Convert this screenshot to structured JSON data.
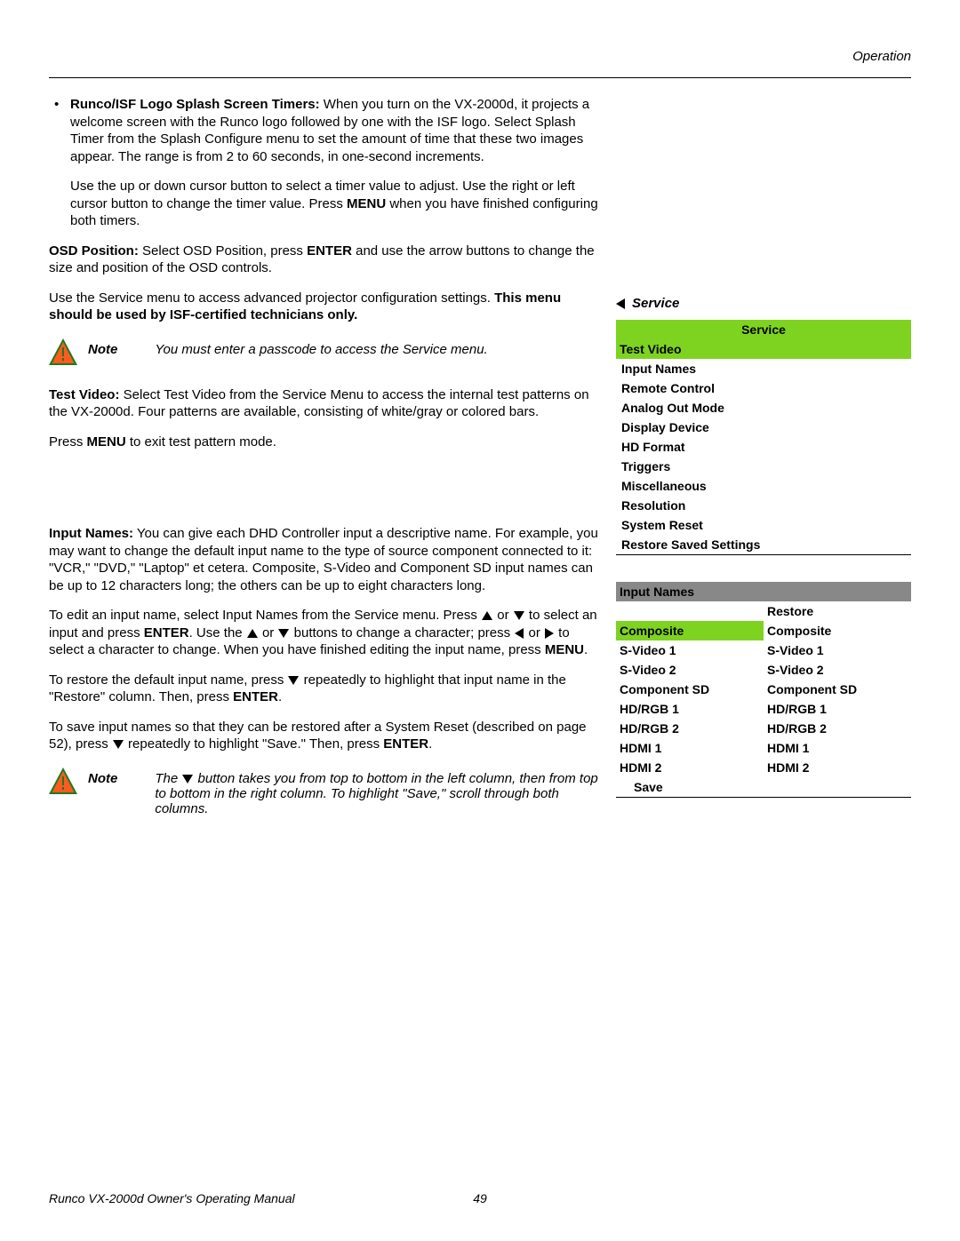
{
  "header": {
    "section": "Operation"
  },
  "bullet": {
    "title": "Runco/ISF Logo Splash Screen Timers:",
    "text": "When you turn on the VX-2000d, it projects a welcome screen with the Runco logo followed by one with the ISF logo. Select Splash Timer from the Splash Configure menu to set the amount of time that these two images appear. The range is from 2 to 60 seconds, in one-second increments."
  },
  "para_cursor": {
    "a": "Use the up or down cursor button to select a timer value to adjust. Use the right or left cursor button to change the timer value. Press ",
    "b": "MENU",
    "c": " when you have finished configuring both timers."
  },
  "osd": {
    "label": "OSD Position:",
    "a": " Select OSD Position, press ",
    "b": "ENTER",
    "c": " and use the arrow buttons to change the size and position of the OSD controls."
  },
  "service_intro": {
    "a": "Use the Service menu to access advanced projector configuration settings. ",
    "b": "This menu should be used by ISF-certified technicians only."
  },
  "note1": {
    "label": "Note",
    "text": "You must enter a passcode to access the Service menu."
  },
  "testvideo": {
    "label": "Test Video:",
    "text": " Select Test Video from the Service Menu to access the internal test patterns on the VX-2000d. Four patterns are available, consisting of white/gray or colored bars."
  },
  "press_menu": {
    "a": "Press ",
    "b": "MENU",
    "c": " to exit test pattern mode."
  },
  "inputnames": {
    "label": "Input Names:",
    "text": " You can give each DHD Controller input a descriptive name. For example, you may want to change the default input name to the type of source component connected to it: \"VCR,\" \"DVD,\" \"Laptop\" et cetera. Composite, S-Video and Component SD input names can be up to 12 characters long; the others can be up to eight characters long."
  },
  "edit": {
    "a": "To edit an input name, select Input Names from the Service menu. Press ",
    "b": " or ",
    "c": " to select an input and press ",
    "d": "ENTER",
    "e": ". Use the ",
    "f": " or ",
    "g": " buttons to change a character; press ",
    "h": " or ",
    "i": " to select a character to change. When you have finished editing the input name, press ",
    "j": "MENU",
    "k": "."
  },
  "restore": {
    "a": "To restore the default input name, press ",
    "b": " repeatedly to highlight that input name in the \"Restore\" column. Then, press ",
    "c": "ENTER",
    "d": "."
  },
  "save": {
    "a": "To save input names so that they can be restored after a System Reset (described on page 52), press ",
    "b": " repeatedly to highlight \"Save.\" Then, press ",
    "c": "ENTER",
    "d": "."
  },
  "note2": {
    "label": "Note",
    "a": "The ",
    "b": " button takes you from top to bottom in the left column, then from top to bottom in the right column. To highlight \"Save,\" scroll through both columns."
  },
  "right": {
    "service_label": "Service",
    "service_menu": {
      "title": "Service",
      "selected": "Test Video",
      "items": [
        "Input Names",
        "Remote Control",
        "Analog Out Mode",
        "Display Device",
        "HD Format",
        "Triggers",
        "Miscellaneous",
        "Resolution",
        "System Reset",
        "Restore Saved Settings"
      ]
    },
    "input_menu": {
      "title": "Input Names",
      "restore": "Restore",
      "rows": [
        [
          "Composite",
          "Composite"
        ],
        [
          "S-Video 1",
          "S-Video 1"
        ],
        [
          "S-Video 2",
          "S-Video 2"
        ],
        [
          "Component SD",
          "Component SD"
        ],
        [
          "HD/RGB 1",
          "HD/RGB 1"
        ],
        [
          "HD/RGB 2",
          "HD/RGB 2"
        ],
        [
          "HDMI 1",
          "HDMI 1"
        ],
        [
          "HDMI 2",
          "HDMI 2"
        ]
      ],
      "save": "Save"
    }
  },
  "footer": {
    "title": "Runco VX-2000d Owner's Operating Manual",
    "page": "49"
  }
}
